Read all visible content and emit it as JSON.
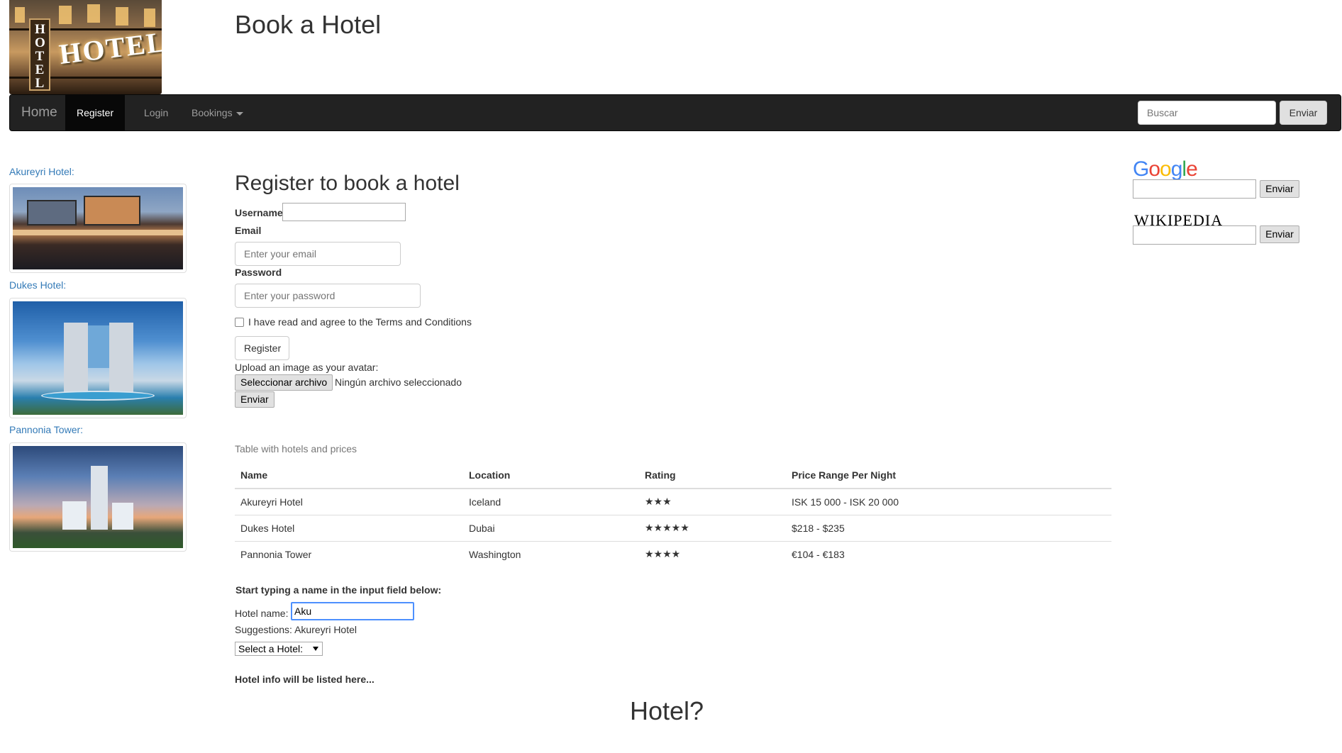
{
  "header": {
    "title": "Book a Hotel",
    "logo_vertical_text": "HOTEL",
    "logo_horizontal_text": "HOTEL"
  },
  "navbar": {
    "brand": "Home",
    "items": [
      {
        "label": "Register",
        "active": true
      },
      {
        "label": "Login",
        "active": false
      },
      {
        "label": "Bookings",
        "active": false,
        "dropdown": true
      }
    ],
    "search": {
      "placeholder": "Buscar",
      "button": "Enviar"
    }
  },
  "sidebar": {
    "hotels": [
      {
        "label": "Akureyri Hotel:"
      },
      {
        "label": "Dukes Hotel:"
      },
      {
        "label": "Pannonia Tower:"
      }
    ]
  },
  "register_form": {
    "heading": "Register to book a hotel",
    "username_label": "Username",
    "username_value": "",
    "email_label": "Email",
    "email_placeholder": "Enter your email",
    "password_label": "Password",
    "password_placeholder": "Enter your password",
    "terms_text": "I have read and agree to the Terms and Conditions",
    "terms_checked": false,
    "register_button": "Register",
    "avatar_label": "Upload an image as your avatar:",
    "file_button": "Seleccionar archivo",
    "file_status": "Ningún archivo seleccionado",
    "submit_button": "Enviar"
  },
  "hotels_table": {
    "caption": "Table with hotels and prices",
    "columns": [
      "Name",
      "Location",
      "Rating",
      "Price Range Per Night"
    ],
    "rows": [
      [
        "Akureyri Hotel",
        "Iceland",
        "★★★",
        "ISK 15 000 - ISK 20 000"
      ],
      [
        "Dukes Hotel",
        "Dubai",
        "★★★★★",
        "$218 - $235"
      ],
      [
        "Pannonia Tower",
        "Washington",
        "★★★★",
        "€104 - €183"
      ]
    ]
  },
  "search_section": {
    "instruction": "Start typing a name in the input field below:",
    "hotel_name_label": "Hotel name:",
    "hotel_name_value": "Aku",
    "suggestions_label": "Suggestions:",
    "suggestions_value": "Akureyri Hotel",
    "select_value": "Select a Hotel:",
    "info_text": "Hotel info will be listed here...",
    "big_text": "Hotel?"
  },
  "widgets": {
    "google_letters": [
      "G",
      "o",
      "o",
      "g",
      "l",
      "e"
    ],
    "google_colors": [
      "#4285f4",
      "#ea4335",
      "#fbbc05",
      "#4285f4",
      "#34a853",
      "#ea4335"
    ],
    "google_button": "Enviar",
    "wikipedia_logo": "WIKIPEDIA",
    "wikipedia_button": "Enviar"
  },
  "colors": {
    "navbar_bg": "#222222",
    "link": "#337ab7",
    "focus_border": "#4d90fe"
  }
}
